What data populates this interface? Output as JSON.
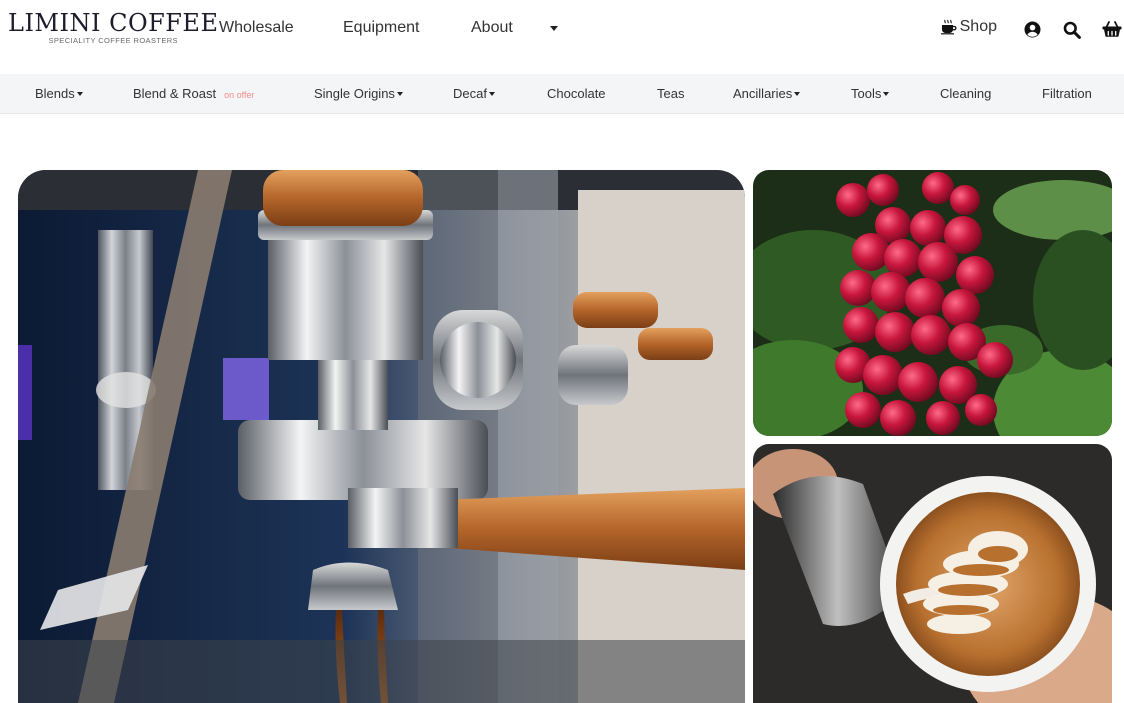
{
  "brand": {
    "name": "LIMINI COFFEE",
    "tagline": "SPECIALITY COFFEE ROASTERS"
  },
  "main_nav": {
    "items": [
      "Wholesale",
      "Equipment",
      "About"
    ],
    "more_icon": "caret-down-icon"
  },
  "toolbar": {
    "shop_label": "Shop",
    "shop_icon": "coffee-cup-icon",
    "account_icon": "user-icon",
    "search_icon": "search-icon",
    "basket_icon": "basket-icon"
  },
  "categories": [
    {
      "label": "Blends",
      "dropdown": true
    },
    {
      "label": "Blend & Roast",
      "dropdown": false,
      "badge": "on offer"
    },
    {
      "label": "Single Origins",
      "dropdown": true
    },
    {
      "label": "Decaf",
      "dropdown": true
    },
    {
      "label": "Chocolate",
      "dropdown": false
    },
    {
      "label": "Teas",
      "dropdown": false
    },
    {
      "label": "Ancillaries",
      "dropdown": true
    },
    {
      "label": "Tools",
      "dropdown": true
    },
    {
      "label": "Cleaning",
      "dropdown": false
    },
    {
      "label": "Filtration",
      "dropdown": false
    }
  ],
  "colors": {
    "category_bar_bg": "#f4f5f7",
    "offer_badge": "#f28c8c",
    "brand_text": "#1c1c2a"
  }
}
